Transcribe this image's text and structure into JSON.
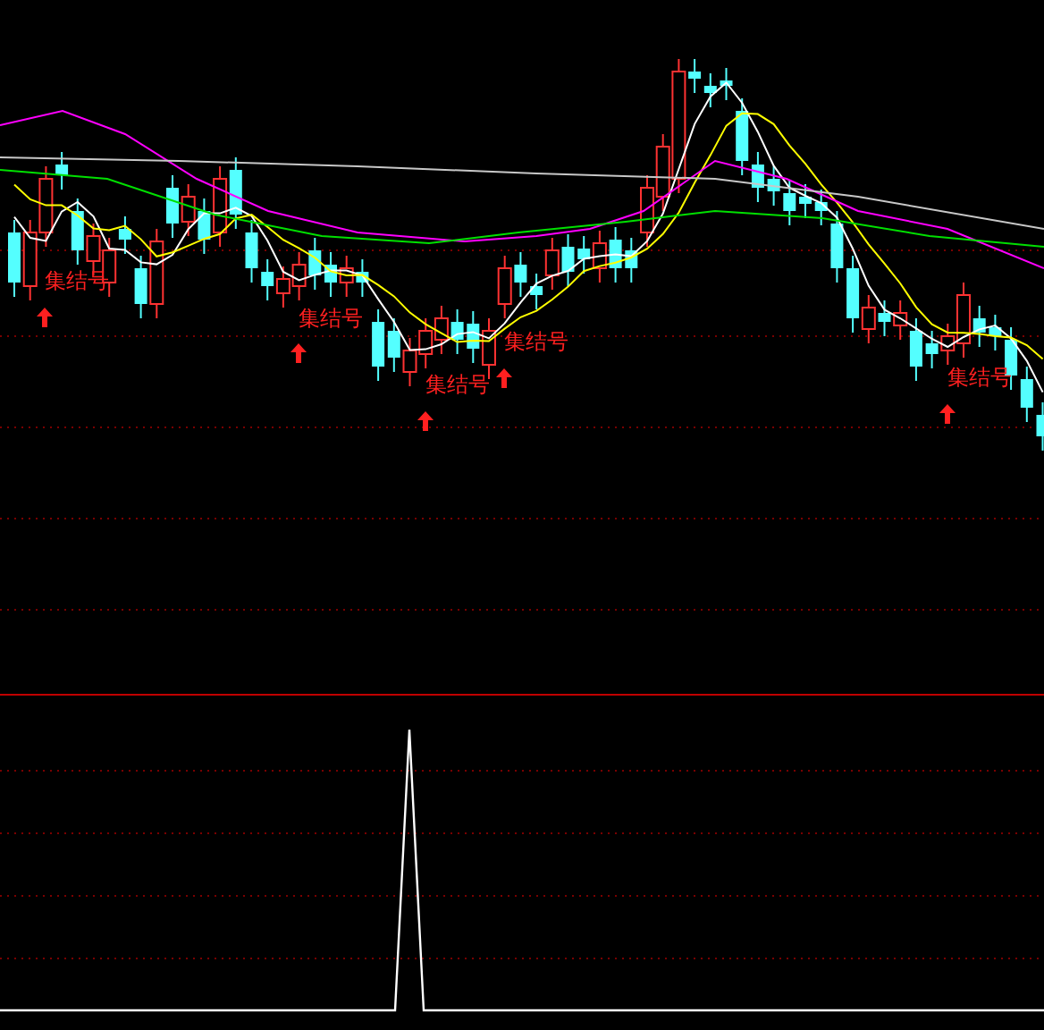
{
  "price_panel": {
    "signals": [
      {
        "label": "集结号"
      },
      {
        "label": "集结号"
      },
      {
        "label": "集结号"
      },
      {
        "label": "集结号"
      },
      {
        "label": "集结号"
      }
    ]
  }
}
